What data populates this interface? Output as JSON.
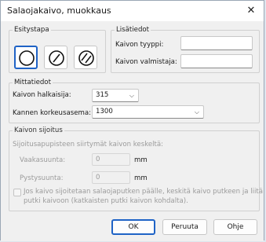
{
  "window": {
    "title": "Salaojakaivo, muokkaus",
    "close_glyph": "✕"
  },
  "esitystapa": {
    "legend": "Esitystapa",
    "icons": [
      "circle-icon",
      "circle-slash-icon",
      "circle-hatched-icon"
    ]
  },
  "lisatiedot": {
    "legend": "Lisätiedot",
    "tyyppi_label": "Kaivon tyyppi:",
    "tyyppi_value": "",
    "valmistaja_label": "Kaivon valmistaja:",
    "valmistaja_value": ""
  },
  "mittatiedot": {
    "legend": "Mittatiedot",
    "halkaisija_label": "Kaivon halkaisija:",
    "halkaisija_value": "315",
    "korkeus_label": "Kannen korkeusasema:",
    "korkeus_value": "1300"
  },
  "sijoitus": {
    "legend": "Kaivon sijoitus",
    "info": "Sijoitusapupisteen siirtymät kaivon keskeltä:",
    "vaaka_label": "Vaakasuunta:",
    "vaaka_value": "0",
    "vaaka_unit": "mm",
    "pysty_label": "Pystysuunta:",
    "pysty_value": "0",
    "pysty_unit": "mm",
    "checkbox_line1": "Jos kaivo sijoitetaan salaojaputken päälle, keskitä kaivo putkeen ja liitä",
    "checkbox_line2": "putki kaivoon (katkaisten putki kaivon kohdalta)."
  },
  "buttons": {
    "ok": "OK",
    "cancel": "Peruuta",
    "help": "Ohje"
  },
  "colors": {
    "accent": "#1f63c6"
  }
}
